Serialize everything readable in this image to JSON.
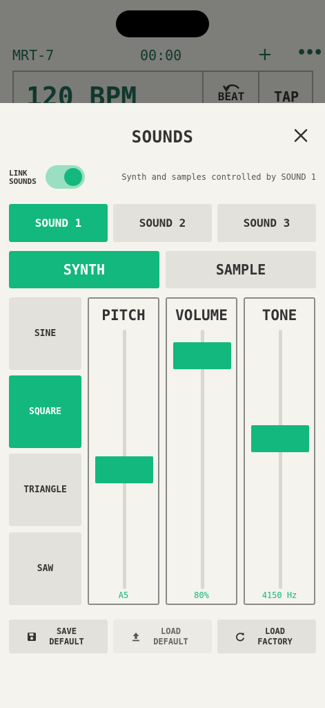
{
  "background_app": {
    "title": "MRT-7",
    "time": "00:00",
    "add_icon": "+",
    "more_icon": "•••",
    "bpm": "120 BPM",
    "beat_label": "BEAT",
    "tap_label": "TAP"
  },
  "sheet": {
    "title": "SOUNDS",
    "close_icon": "close-icon",
    "link_label_line1": "LINK",
    "link_label_line2": "SOUNDS",
    "link_on": true,
    "link_info": "Synth and samples controlled by SOUND 1"
  },
  "sound_tabs": [
    {
      "label": "SOUND 1",
      "active": true
    },
    {
      "label": "SOUND 2",
      "active": false
    },
    {
      "label": "SOUND 3",
      "active": false
    }
  ],
  "mode_tabs": [
    {
      "label": "SYNTH",
      "active": true
    },
    {
      "label": "SAMPLE",
      "active": false
    }
  ],
  "waveforms": [
    {
      "label": "SINE",
      "active": false
    },
    {
      "label": "SQUARE",
      "active": true
    },
    {
      "label": "TRIANGLE",
      "active": false
    },
    {
      "label": "SAW",
      "active": false
    }
  ],
  "sliders": [
    {
      "title": "PITCH",
      "value_label": "A5",
      "level": 0.46
    },
    {
      "title": "VOLUME",
      "value_label": "80%",
      "level": 0.9
    },
    {
      "title": "TONE",
      "value_label": "4150 Hz",
      "level": 0.58
    }
  ],
  "footer": [
    {
      "line1": "SAVE",
      "line2": "DEFAULT",
      "icon": "save-icon",
      "enabled": true
    },
    {
      "line1": "LOAD",
      "line2": "DEFAULT",
      "icon": "upload-icon",
      "enabled": false
    },
    {
      "line1": "LOAD",
      "line2": "FACTORY",
      "icon": "refresh-icon",
      "enabled": true
    }
  ],
  "colors": {
    "accent": "#12b87d",
    "accent_light": "#9adfc0",
    "button_bg": "#e2e1db",
    "sheet_bg": "#f4f3ed",
    "text": "#333333"
  }
}
